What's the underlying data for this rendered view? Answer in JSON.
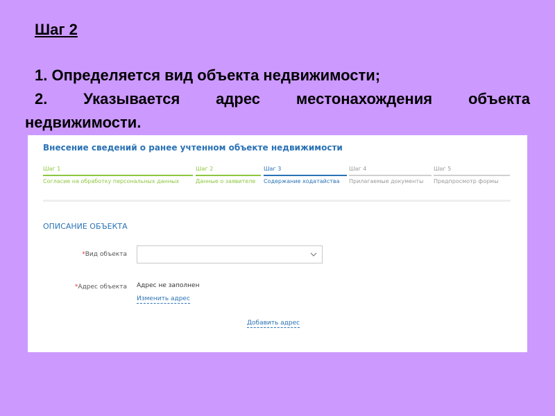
{
  "slide": {
    "title": "Шаг 2",
    "line1": "1. Определяется вид объекта недвижимости;",
    "line2": "2. Указывается адрес местонахождения объекта",
    "line3": "недвижимости."
  },
  "form": {
    "title": "Внесение сведений о ранее учтенном объекте недвижимости",
    "steps": [
      {
        "num": "Шаг 1",
        "name": "Согласие на обработку персональных данных",
        "state": "done"
      },
      {
        "num": "Шаг 2",
        "name": "Данные о заявителе",
        "state": "done"
      },
      {
        "num": "Шаг 3",
        "name": "Содержание ходатайства",
        "state": "active"
      },
      {
        "num": "Шаг 4",
        "name": "Прилагаемые документы",
        "state": "pending"
      },
      {
        "num": "Шаг 5",
        "name": "Предпросмотр формы",
        "state": "pending"
      }
    ],
    "section_title": "ОПИСАНИЕ ОБЪЕКТА",
    "object_type": {
      "required_mark": "*",
      "label": "Вид объекта",
      "value": ""
    },
    "address": {
      "required_mark": "*",
      "label": "Адрес объекта",
      "value": "Адрес не заполнен",
      "change_link": "Изменить адрес"
    },
    "add_address_link": "Добавить адрес"
  },
  "colors": {
    "background": "#cc99ff",
    "accent": "#2a72b5",
    "done": "#8cc63f",
    "required": "#e53935"
  },
  "icons": {
    "select": "chevron-down-icon"
  }
}
